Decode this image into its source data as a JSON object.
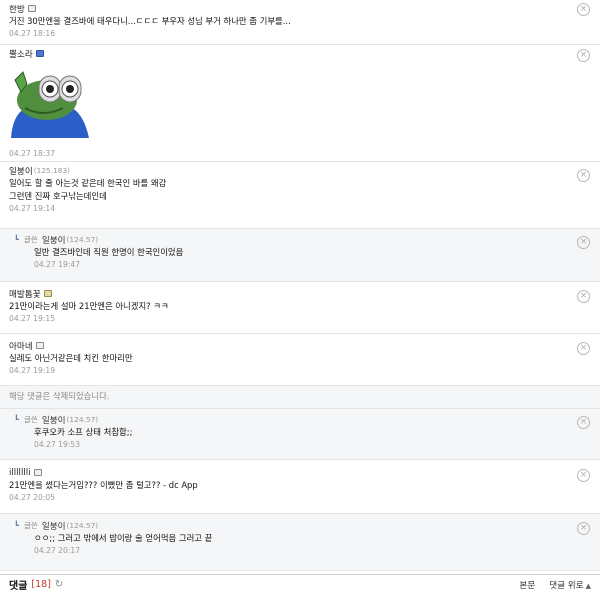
{
  "comments": [
    {
      "nick": "한방",
      "text": "거진 30만엔을 결즈바에 태우다니...ㄷㄷㄷ 부우자 성님 부거 하나만 좀 기부를...",
      "date": "04.27 18:16"
    },
    {
      "nick": "뿔소라",
      "date": "04.27 18:37"
    },
    {
      "nick": "일붕이",
      "ip": "(125.183)",
      "text1": "일어도 할 줄 아는것 같은데 한국인 바를 왜감",
      "text2": "그런덴 진짜 호구낚는데인데",
      "date": "04.27 19:14"
    },
    {
      "label": "글쓴",
      "nick": "일붕이",
      "ip": "(124.57)",
      "text": "일반 결즈바인데 직원 한명이 한국인이었음",
      "date": "04.27 19:47"
    },
    {
      "nick": "매발톱꽃",
      "text": "21만이라는게 설마 21만엔은 아니겠지? ㅋㅋ",
      "date": "04.27 19:15"
    },
    {
      "nick": "아마네",
      "text": "실례도 아닌거같은데 치킨 한마리만",
      "date": "04.27 19:19"
    },
    {
      "deleted": "해당 댓글은 삭제되었습니다."
    },
    {
      "label": "글쓴",
      "nick": "일붕이",
      "ip": "(124.57)",
      "text": "후쿠오카 소프 상태 처참함;;",
      "date": "04.27 19:53"
    },
    {
      "nick": "illllllli",
      "text": "21만엔을 썼다는거임??? 이뻤만 좀 털고?? - dc App",
      "date": "04.27 20:05"
    },
    {
      "label": "글쓴",
      "nick": "일붕이",
      "ip": "(124.57)",
      "text": "ㅇㅇ;; 그러고 밖에서 밥이랑 술 얻어먹음 그러고 끝",
      "date": "04.27 20:17"
    }
  ],
  "footer": {
    "title": "댓글",
    "count": "[18]",
    "main_label": "본문",
    "top_label": "댓글 위로"
  },
  "icons": {
    "close": "close-circle-icon",
    "reply": "reply-arrow-icon",
    "refresh": "refresh-icon",
    "up": "triangle-up-icon",
    "user": "user-badge-icon",
    "sticker": "pepe-binoculars-sticker"
  }
}
